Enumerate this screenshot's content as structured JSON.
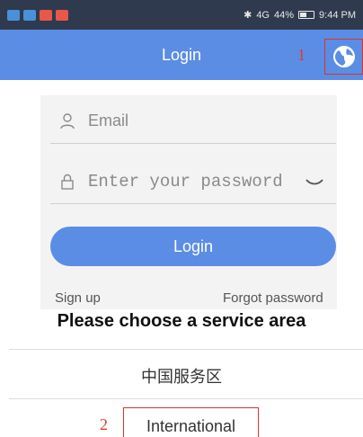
{
  "status_bar": {
    "notifications": [
      "#4a90d9",
      "#4a90d9",
      "#e8574a",
      "#e8574a"
    ],
    "signal_text": "4G",
    "battery": "44%",
    "time": "9:44 PM"
  },
  "app_bar": {
    "title": "Login",
    "globe_icon": "globe-icon",
    "marker": "1"
  },
  "form": {
    "email_placeholder": "Email",
    "password_placeholder": "Enter your password",
    "login_label": "Login",
    "signup_label": "Sign up",
    "forgot_label": "Forgot password"
  },
  "service_area": {
    "heading": "Please choose a service area",
    "option_china": "中国服务区",
    "option_international": "International",
    "marker": "2"
  },
  "colors": {
    "accent": "#5b8de4",
    "annotation_red": "#d9332b"
  }
}
